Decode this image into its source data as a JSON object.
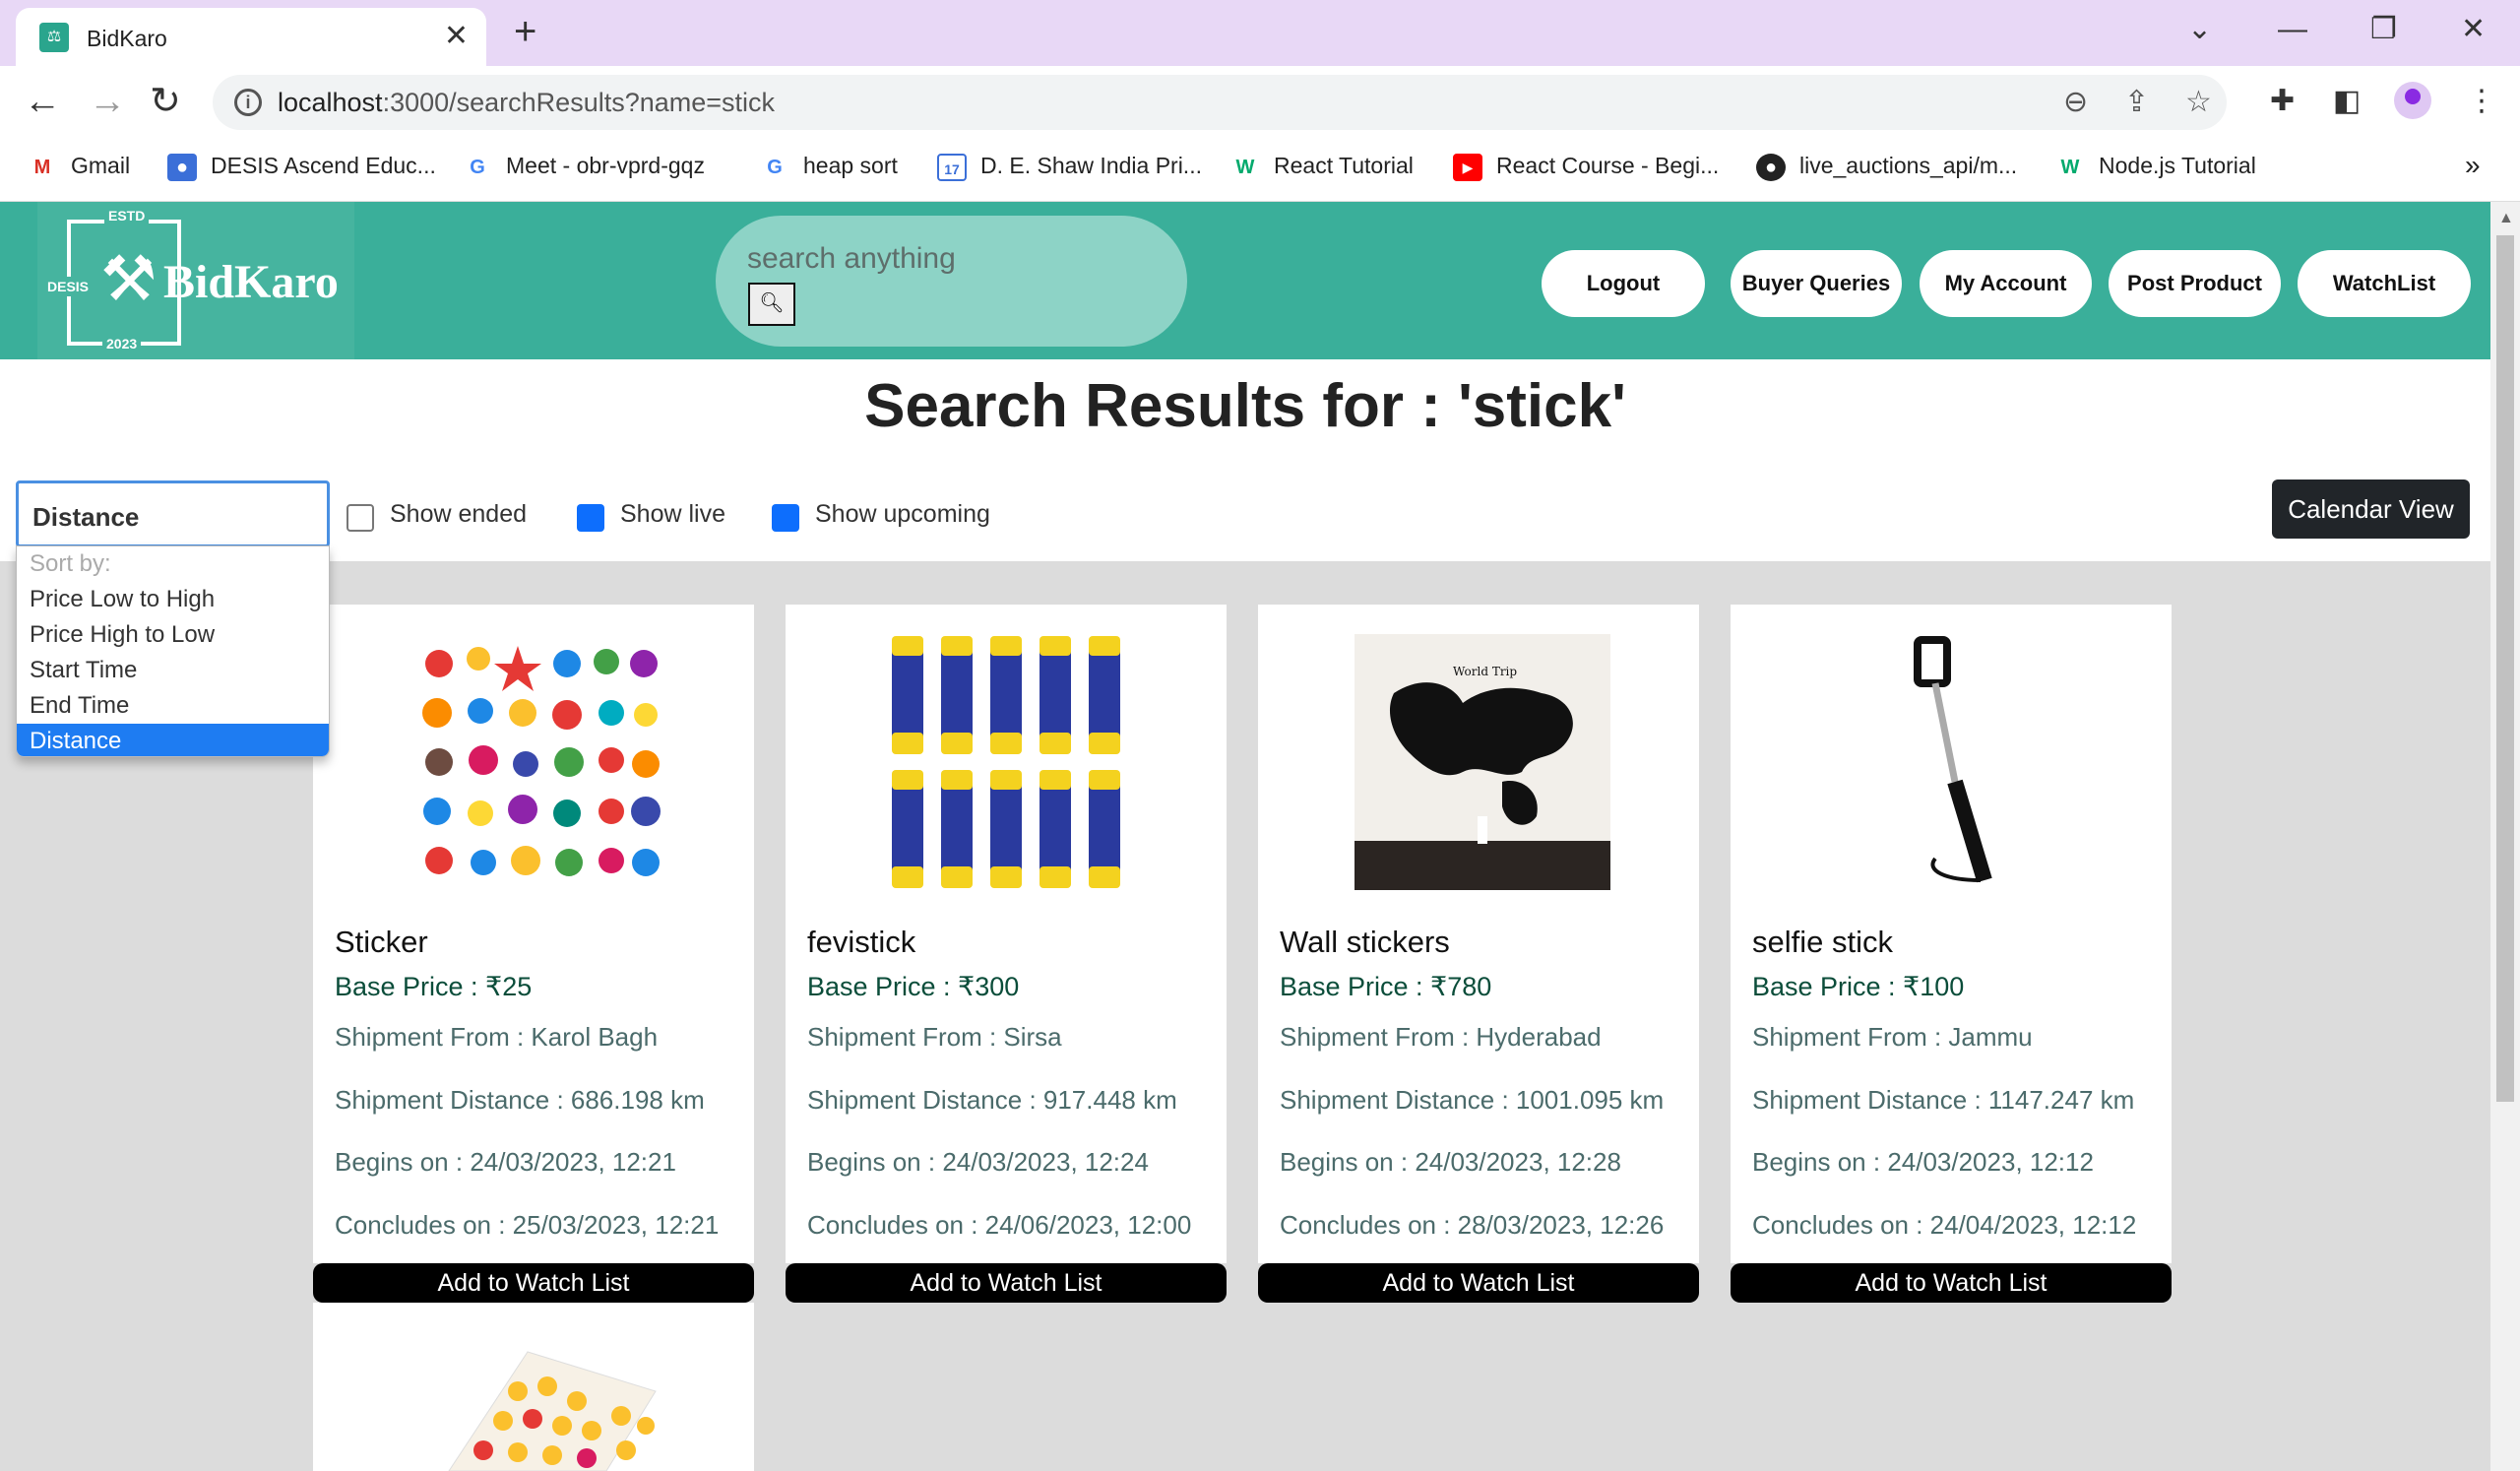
{
  "browser": {
    "tab_title": "BidKaro",
    "url_host": "localhost",
    "url_rest": ":3000/searchResults?name=stick",
    "bookmarks": [
      {
        "label": "Gmail"
      },
      {
        "label": "DESIS Ascend Educ..."
      },
      {
        "label": "Meet - obr-vprd-gqz"
      },
      {
        "label": "heap sort"
      },
      {
        "label": "D. E. Shaw India Pri..."
      },
      {
        "label": "React Tutorial"
      },
      {
        "label": "React Course - Begi..."
      },
      {
        "label": "live_auctions_api/m..."
      },
      {
        "label": "Node.js Tutorial"
      }
    ]
  },
  "header": {
    "logo": {
      "estd": "ESTD",
      "desis": "DESIS",
      "name": "BidKaro",
      "year": "2023"
    },
    "search_placeholder": "search anything",
    "buttons": [
      "Logout",
      "Buyer Queries",
      "My Account",
      "Post Product",
      "WatchList"
    ]
  },
  "main": {
    "title": "Search Results for : 'stick'",
    "sort": {
      "selected": "Distance",
      "options": [
        "Sort by:",
        "Price Low to High",
        "Price High to Low",
        "Start Time",
        "End Time",
        "Distance"
      ]
    },
    "filters": {
      "show_ended": "Show ended",
      "show_live": "Show live",
      "show_upcoming": "Show upcoming"
    },
    "calendar_button": "Calendar View",
    "watch_button": "Add to Watch List",
    "products": [
      {
        "name": "Sticker",
        "price": "Base Price : ₹25",
        "from": "Shipment From : Karol Bagh",
        "distance": "Shipment Distance : 686.198 km",
        "begins": "Begins on : 24/03/2023, 12:21",
        "concludes": "Concludes on : 25/03/2023, 12:21"
      },
      {
        "name": "fevistick",
        "price": "Base Price : ₹300",
        "from": "Shipment From : Sirsa",
        "distance": "Shipment Distance : 917.448 km",
        "begins": "Begins on : 24/03/2023, 12:24",
        "concludes": "Concludes on : 24/06/2023, 12:00"
      },
      {
        "name": "Wall stickers",
        "price": "Base Price : ₹780",
        "from": "Shipment From : Hyderabad",
        "distance": "Shipment Distance : 1001.095 km",
        "begins": "Begins on : 24/03/2023, 12:28",
        "concludes": "Concludes on : 28/03/2023, 12:26"
      },
      {
        "name": "selfie stick",
        "price": "Base Price : ₹100",
        "from": "Shipment From : Jammu",
        "distance": "Shipment Distance : 1147.247 km",
        "begins": "Begins on : 24/03/2023, 12:12",
        "concludes": "Concludes on : 24/04/2023, 12:12"
      }
    ],
    "product_images": {
      "sticker": {
        "artwork": "World Trip"
      }
    }
  }
}
